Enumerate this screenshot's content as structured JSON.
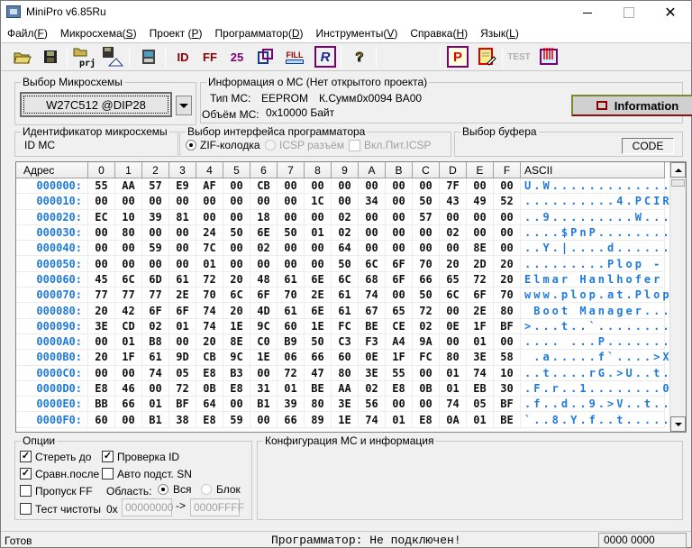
{
  "window": {
    "title": "MiniPro v6.85Ru"
  },
  "menu": [
    {
      "label": "Файл",
      "key": "F"
    },
    {
      "label": "Микросхема",
      "key": "S"
    },
    {
      "label": "Проект ",
      "key": "P"
    },
    {
      "label": "Программатор",
      "key": "D"
    },
    {
      "label": "Инструменты",
      "key": "V"
    },
    {
      "label": "Справка",
      "key": "H"
    },
    {
      "label": "Язык",
      "key": "L"
    }
  ],
  "toolbar": {
    "open": "open-file-icon",
    "save": "save-icon",
    "open_project_label": "prj",
    "fill_label": "FILL",
    "id_label": "ID",
    "ff_label": "FF",
    "n25_label": "25",
    "r_label": "R",
    "help_label": "?",
    "p_label": "P",
    "test_label": "TEST"
  },
  "chip_select": {
    "title": "Выбор Микросхемы",
    "value": "W27C512 @DIP28"
  },
  "chip_info": {
    "title": "Информация о МС (Нет открытого проекта)",
    "type_label": "Тип МС:",
    "type_value": "EEPROM",
    "checksum_label": "К.Сумм:",
    "checksum_value": "0x0094 BA00",
    "size_label": "Объём МС:",
    "size_value": "0x10000 Байт",
    "info_button": "Information"
  },
  "chip_id": {
    "title": "Идентификатор микросхемы",
    "value": "ID MC"
  },
  "interface": {
    "title": "Выбор интерфейса программатора",
    "zif": "ZIF-колодка",
    "icsp": "ICSP разъём",
    "icsp_power": "Вкл.Пит.ICSP",
    "selected": "zif"
  },
  "buffer": {
    "title": "Выбор буфера",
    "value": "CODE"
  },
  "hex": {
    "headers": [
      "Адрес",
      "0",
      "1",
      "2",
      "3",
      "4",
      "5",
      "6",
      "7",
      "8",
      "9",
      "A",
      "B",
      "C",
      "D",
      "E",
      "F",
      "ASCII"
    ],
    "rows": [
      {
        "addr": "000000:",
        "bytes": [
          "55",
          "AA",
          "57",
          "E9",
          "AF",
          "00",
          "CB",
          "00",
          "00",
          "00",
          "00",
          "00",
          "00",
          "7F",
          "00",
          "00"
        ],
        "ascii": "U.W............."
      },
      {
        "addr": "000010:",
        "bytes": [
          "00",
          "00",
          "00",
          "00",
          "00",
          "00",
          "00",
          "00",
          "1C",
          "00",
          "34",
          "00",
          "50",
          "43",
          "49",
          "52"
        ],
        "ascii": "..........4.PCIR"
      },
      {
        "addr": "000020:",
        "bytes": [
          "EC",
          "10",
          "39",
          "81",
          "00",
          "00",
          "18",
          "00",
          "00",
          "02",
          "00",
          "00",
          "57",
          "00",
          "00",
          "00"
        ],
        "ascii": "..9.........W..."
      },
      {
        "addr": "000030:",
        "bytes": [
          "00",
          "80",
          "00",
          "00",
          "24",
          "50",
          "6E",
          "50",
          "01",
          "02",
          "00",
          "00",
          "00",
          "02",
          "00",
          "00"
        ],
        "ascii": "....$PnP........"
      },
      {
        "addr": "000040:",
        "bytes": [
          "00",
          "00",
          "59",
          "00",
          "7C",
          "00",
          "02",
          "00",
          "00",
          "64",
          "00",
          "00",
          "00",
          "00",
          "8E",
          "00"
        ],
        "ascii": "..Y.|....d......"
      },
      {
        "addr": "000050:",
        "bytes": [
          "00",
          "00",
          "00",
          "00",
          "01",
          "00",
          "00",
          "00",
          "00",
          "50",
          "6C",
          "6F",
          "70",
          "20",
          "2D",
          "20"
        ],
        "ascii": ".........Plop - "
      },
      {
        "addr": "000060:",
        "bytes": [
          "45",
          "6C",
          "6D",
          "61",
          "72",
          "20",
          "48",
          "61",
          "6E",
          "6C",
          "68",
          "6F",
          "66",
          "65",
          "72",
          "20"
        ],
        "ascii": "Elmar Hanlhofer "
      },
      {
        "addr": "000070:",
        "bytes": [
          "77",
          "77",
          "77",
          "2E",
          "70",
          "6C",
          "6F",
          "70",
          "2E",
          "61",
          "74",
          "00",
          "50",
          "6C",
          "6F",
          "70"
        ],
        "ascii": "www.plop.at.Plop"
      },
      {
        "addr": "000080:",
        "bytes": [
          "20",
          "42",
          "6F",
          "6F",
          "74",
          "20",
          "4D",
          "61",
          "6E",
          "61",
          "67",
          "65",
          "72",
          "00",
          "2E",
          "80"
        ],
        "ascii": " Boot Manager..."
      },
      {
        "addr": "000090:",
        "bytes": [
          "3E",
          "CD",
          "02",
          "01",
          "74",
          "1E",
          "9C",
          "60",
          "1E",
          "FC",
          "BE",
          "CE",
          "02",
          "0E",
          "1F",
          "BF"
        ],
        "ascii": ">...t..`........"
      },
      {
        "addr": "0000A0:",
        "bytes": [
          "00",
          "01",
          "B8",
          "00",
          "20",
          "8E",
          "C0",
          "B9",
          "50",
          "C3",
          "F3",
          "A4",
          "9A",
          "00",
          "01",
          "00"
        ],
        "ascii": ".... ...P......."
      },
      {
        "addr": "0000B0:",
        "bytes": [
          "20",
          "1F",
          "61",
          "9D",
          "CB",
          "9C",
          "1E",
          "06",
          "66",
          "60",
          "0E",
          "1F",
          "FC",
          "80",
          "3E",
          "58"
        ],
        "ascii": " .a.....f`....>X"
      },
      {
        "addr": "0000C0:",
        "bytes": [
          "00",
          "00",
          "74",
          "05",
          "E8",
          "B3",
          "00",
          "72",
          "47",
          "80",
          "3E",
          "55",
          "00",
          "01",
          "74",
          "10"
        ],
        "ascii": "..t....rG.>U..t."
      },
      {
        "addr": "0000D0:",
        "bytes": [
          "E8",
          "46",
          "00",
          "72",
          "0B",
          "E8",
          "31",
          "01",
          "BE",
          "AA",
          "02",
          "E8",
          "0B",
          "01",
          "EB",
          "30"
        ],
        "ascii": ".F.r..1........0"
      },
      {
        "addr": "0000E0:",
        "bytes": [
          "BB",
          "66",
          "01",
          "BF",
          "64",
          "00",
          "B1",
          "39",
          "80",
          "3E",
          "56",
          "00",
          "00",
          "74",
          "05",
          "BF"
        ],
        "ascii": ".f..d..9.>V..t.."
      },
      {
        "addr": "0000F0:",
        "bytes": [
          "60",
          "00",
          "B1",
          "38",
          "E8",
          "59",
          "00",
          "66",
          "89",
          "1E",
          "74",
          "01",
          "E8",
          "0A",
          "01",
          "BE"
        ],
        "ascii": "`..8.Y.f..t....."
      }
    ]
  },
  "options": {
    "title": "Опции",
    "erase_before": {
      "label": "Стереть до",
      "checked": true
    },
    "verify_after": {
      "label": "Сравн.после",
      "checked": true
    },
    "skip_ff": {
      "label": "Пропуск FF",
      "checked": false
    },
    "blank_test": {
      "label": "Тест чистоты",
      "checked": false
    },
    "check_id": {
      "label": "Проверка ID",
      "checked": true
    },
    "auto_sn": {
      "label": "Авто подст. SN",
      "checked": false
    },
    "area_label": "Область:",
    "area_all": "Вся",
    "area_block": "Блок",
    "area_selected": "all",
    "hex_prefix": "0x",
    "range_from": "00000000",
    "arrow": "->",
    "range_to": "0000FFFF"
  },
  "config": {
    "title": "Конфигурация МС и информация"
  },
  "status": {
    "left": "Готов",
    "middle": "Программатор: Не подключен!",
    "right": "0000 0000"
  }
}
